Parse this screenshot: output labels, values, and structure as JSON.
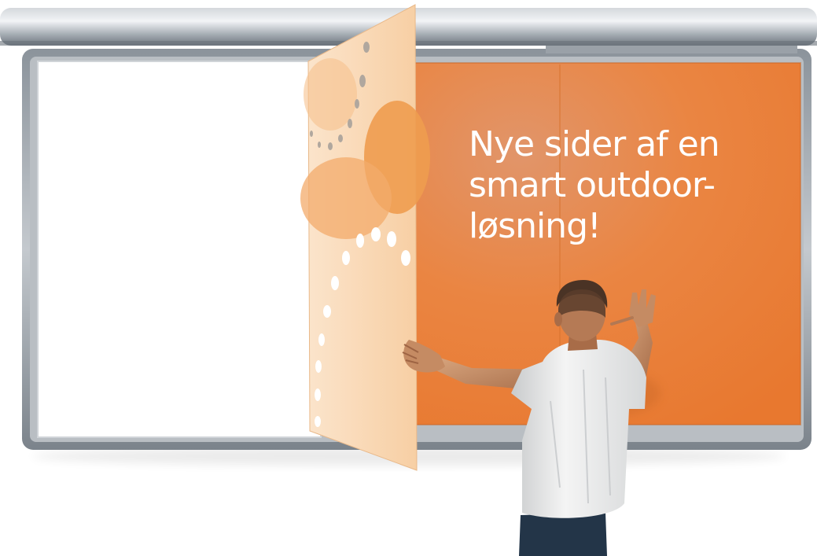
{
  "headline": {
    "line1": "Nye sider af en",
    "line2": "smart outdoor-",
    "line3": "løsning!"
  },
  "colors": {
    "accent_orange": "#ec8035",
    "frame_silver": "#9ca3aa",
    "panel_peach": "#f9d9b6",
    "page_white": "#ffffff",
    "shirt_white": "#f2f2f2",
    "jeans_blue": "#223447"
  },
  "icons": {
    "rail": "aluminium-rail",
    "figure": "man-turning-page"
  }
}
